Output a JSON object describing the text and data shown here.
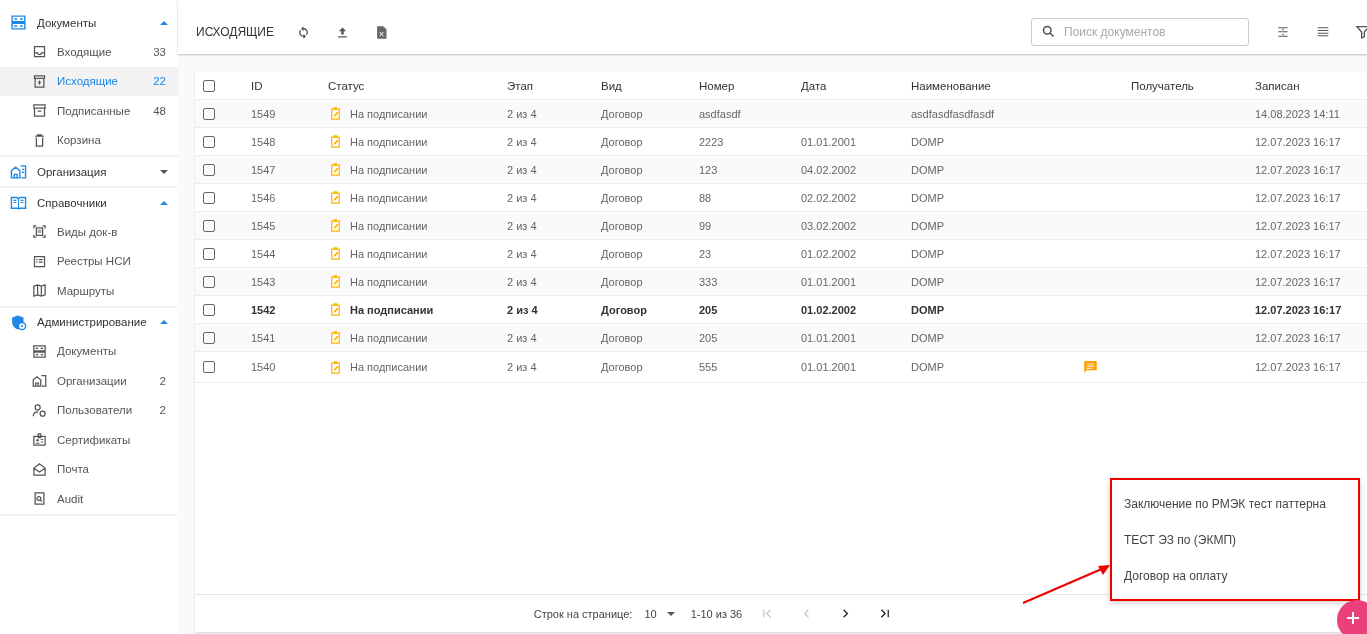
{
  "sidebar": {
    "groups": [
      {
        "label": "Документы",
        "expanded": true,
        "children": [
          {
            "label": "Входящие",
            "count": "33",
            "selected": false
          },
          {
            "label": "Исходящие",
            "count": "22",
            "selected": true
          },
          {
            "label": "Подписанные",
            "count": "48",
            "selected": false
          },
          {
            "label": "Корзина",
            "selected": false
          }
        ]
      },
      {
        "label": "Организация",
        "expanded": false
      },
      {
        "label": "Справочники",
        "expanded": true,
        "children": [
          {
            "label": "Виды док-в",
            "selected": false
          },
          {
            "label": "Реестры НСИ",
            "selected": false
          },
          {
            "label": "Маршруты",
            "selected": false
          }
        ]
      },
      {
        "label": "Администрирование",
        "expanded": true,
        "children": [
          {
            "label": "Документы",
            "selected": false
          },
          {
            "label": "Организации",
            "count": "2",
            "selected": false
          },
          {
            "label": "Пользователи",
            "count": "2",
            "selected": false
          },
          {
            "label": "Сертификаты",
            "selected": false
          },
          {
            "label": "Почта",
            "selected": false
          },
          {
            "label": "Audit",
            "selected": false
          }
        ]
      }
    ]
  },
  "toolbar": {
    "title": "ИСХОДЯЩИЕ",
    "search": {
      "placeholder": "Поиск документов"
    }
  },
  "table": {
    "select_all": {
      "checked": false
    },
    "columns": [
      "ID",
      "Статус",
      "Этап",
      "Вид",
      "Номер",
      "Дата",
      "Наименование",
      "Получатель",
      "Записан"
    ],
    "rows": [
      {
        "checked": false,
        "unread": false,
        "comment": false,
        "id": "1549",
        "status": "На подписании",
        "stage": "2 из 4",
        "kind": "Договор",
        "number": "asdfasdf",
        "name": "asdfasdfasdfasdf",
        "recorded": "14.08.2023 14:11"
      },
      {
        "checked": false,
        "unread": false,
        "comment": false,
        "id": "1548",
        "status": "На подписании",
        "stage": "2 из 4",
        "kind": "Договор",
        "number": "2223",
        "date": "01.01.2001",
        "name": "DOMP",
        "recorded": "12.07.2023 16:17"
      },
      {
        "checked": false,
        "unread": false,
        "comment": false,
        "id": "1547",
        "status": "На подписании",
        "stage": "2 из 4",
        "kind": "Договор",
        "number": "123",
        "date": "04.02.2002",
        "name": "DOMP",
        "recorded": "12.07.2023 16:17"
      },
      {
        "checked": false,
        "unread": false,
        "comment": false,
        "id": "1546",
        "status": "На подписании",
        "stage": "2 из 4",
        "kind": "Договор",
        "number": "88",
        "date": "02.02.2002",
        "name": "DOMP",
        "recorded": "12.07.2023 16:17"
      },
      {
        "checked": false,
        "unread": false,
        "comment": false,
        "id": "1545",
        "status": "На подписании",
        "stage": "2 из 4",
        "kind": "Договор",
        "number": "99",
        "date": "03.02.2002",
        "name": "DOMP",
        "recorded": "12.07.2023 16:17"
      },
      {
        "checked": false,
        "unread": false,
        "comment": false,
        "id": "1544",
        "status": "На подписании",
        "stage": "2 из 4",
        "kind": "Договор",
        "number": "23",
        "date": "01.02.2002",
        "name": "DOMP",
        "recorded": "12.07.2023 16:17"
      },
      {
        "checked": false,
        "unread": false,
        "comment": false,
        "id": "1543",
        "status": "На подписании",
        "stage": "2 из 4",
        "kind": "Договор",
        "number": "333",
        "date": "01.01.2001",
        "name": "DOMP",
        "recorded": "12.07.2023 16:17"
      },
      {
        "checked": false,
        "unread": true,
        "comment": false,
        "id": "1542",
        "status": "На подписании",
        "stage": "2 из 4",
        "kind": "Договор",
        "number": "205",
        "date": "01.02.2002",
        "name": "DOMP",
        "recorded": "12.07.2023 16:17"
      },
      {
        "checked": false,
        "unread": false,
        "comment": false,
        "id": "1541",
        "status": "На подписании",
        "stage": "2 из 4",
        "kind": "Договор",
        "number": "205",
        "date": "01.01.2001",
        "name": "DOMP",
        "recorded": "12.07.2023 16:17"
      },
      {
        "checked": false,
        "unread": false,
        "comment": true,
        "id": "1540",
        "status": "На подписании",
        "stage": "2 из 4",
        "kind": "Договор",
        "number": "555",
        "date": "01.01.2001",
        "name": "DOMP",
        "recorded": "12.07.2023 16:17"
      }
    ]
  },
  "pagination": {
    "rows_label": "Строк на странице:",
    "rows_value": "10",
    "range": "1-10 из 36",
    "buttons": [
      {
        "kind": "first",
        "disabled": true
      },
      {
        "kind": "prev",
        "disabled": true
      },
      {
        "kind": "next",
        "disabled": false
      },
      {
        "kind": "last",
        "disabled": false
      }
    ]
  },
  "create_menu": {
    "items": [
      "Заключение по РМЭК тест паттерна",
      "ТЕСТ ЭЗ по (ЭКМП)",
      "Договор на оплату"
    ]
  }
}
